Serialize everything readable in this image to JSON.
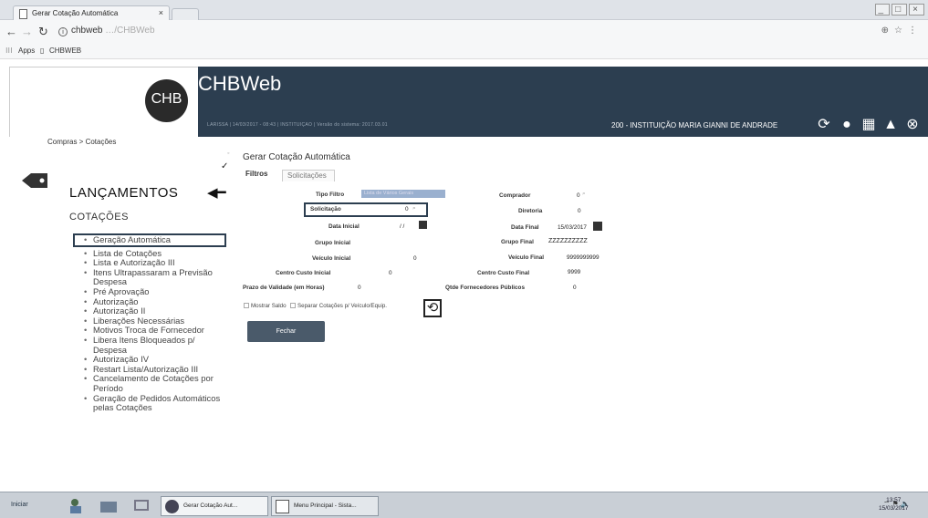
{
  "browser": {
    "tab_title": "Gerar Cotação Automática",
    "tab_close": "×",
    "url_host": "chbweb",
    "url_path": "…/CHBWeb",
    "bookmarks": [
      "Apps",
      "CHBWEB"
    ]
  },
  "header": {
    "logo_text": "CHB",
    "app_title": "CHBWeb",
    "subline": "LARISSA | 14/03/2017 - 08:43 | INSTITUIÇÃO | Versão do sistema: 2017.03.01",
    "institution": "200 - INSTITUIÇÃO MARIA GIANNI DE ANDRADE"
  },
  "breadcrumb": "Compras > Cotações",
  "sidebar": {
    "section": "LANÇAMENTOS",
    "subsection": "COTAÇÕES",
    "items": [
      "Geração Automática",
      "Lista de Cotações",
      "Lista e Autorização III",
      "Itens Ultrapassaram a Previsão Despesa",
      "Pré Aprovação",
      "Autorização",
      "Autorização II",
      "Liberações Necessárias",
      "Motivos Troca de Fornecedor",
      "Libera Itens Bloqueados p/ Despesa",
      "Autorização IV",
      "Restart Lista/Autorização III",
      "Cancelamento de Cotações por Período",
      "Geração de Pedidos Automáticos pelas Cotações"
    ]
  },
  "main": {
    "title": "Gerar Cotação Automática",
    "tabs": [
      "Filtros",
      "Solicitações"
    ],
    "form_left": {
      "tipo_filtro_label": "Tipo Filtro",
      "tipo_filtro_value": "Lista de Vários Gerais",
      "solicitacao_label": "Solicitação",
      "solicitacao_value": "0",
      "data_inicial_label": "Data Inicial",
      "data_inicial_value": "/ /",
      "grupo_inicial_label": "Grupo Inicial",
      "veiculo_inicial_label": "Veículo Inicial",
      "veiculo_inicial_value": "0",
      "centro_custo_inicial_label": "Centro Custo Inicial",
      "centro_custo_inicial_value": "0",
      "prazo_validade_label": "Prazo de Validade (em Horas)",
      "prazo_validade_value": "0"
    },
    "form_right": {
      "comprador_label": "Comprador",
      "comprador_value": "0",
      "diretoria_label": "Diretoria",
      "diretoria_value": "0",
      "data_final_label": "Data Final",
      "data_final_value": "15/03/2017",
      "grupo_final_label": "Grupo Final",
      "grupo_final_value": "ZZZZZZZZZZ",
      "veiculo_final_label": "Veículo Final",
      "veiculo_final_value": "9999999999",
      "centro_custo_final_label": "Centro Custo Final",
      "centro_custo_final_value": "9999",
      "qtde_fornecedores_label": "Qtde Fornecedores Públicos",
      "qtde_fornecedores_value": "0"
    },
    "checkboxes": [
      "Mostrar Saldo",
      "Separar Cotações p/ Veículo/Equip."
    ],
    "close_button": "Fechar"
  },
  "taskbar": {
    "start": "Iniciar",
    "tasks": [
      "Gerar Cotação Aut...",
      "Menu Principal - Sista..."
    ],
    "time": "13:57",
    "date": "15/03/2017"
  },
  "colors": {
    "header_bg": "#2c3e50",
    "button_bg": "#4a5a6a",
    "select_bg": "#9ab0cf"
  }
}
